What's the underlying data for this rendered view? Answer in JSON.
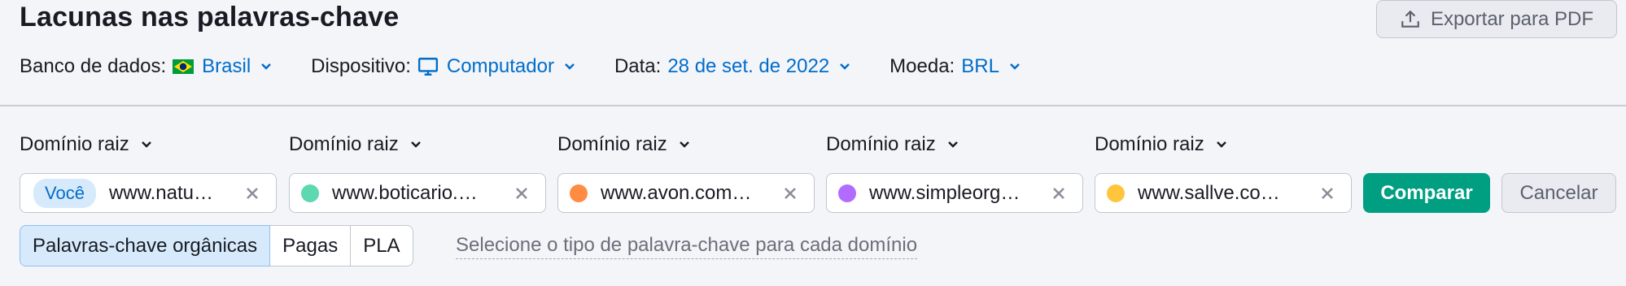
{
  "page": {
    "title": "Lacunas nas palavras-chave"
  },
  "export": {
    "label": "Exportar para PDF",
    "icon": "upload-icon"
  },
  "filters": {
    "database": {
      "label": "Banco de dados:",
      "value": "Brasil",
      "icon": "brazil-flag-icon"
    },
    "device": {
      "label": "Dispositivo:",
      "value": "Computador",
      "icon": "monitor-icon"
    },
    "date": {
      "label": "Data:",
      "value": "28 de set. de 2022"
    },
    "currency": {
      "label": "Moeda:",
      "value": "BRL"
    }
  },
  "domains": [
    {
      "type_label": "Domínio raiz",
      "value": "www.natu…",
      "badge": "Você"
    },
    {
      "type_label": "Domínio raiz",
      "value": "www.boticario.…",
      "color": "#5ed8b0"
    },
    {
      "type_label": "Domínio raiz",
      "value": "www.avon.com…",
      "color": "#ff8c42"
    },
    {
      "type_label": "Domínio raiz",
      "value": "www.simpleorg…",
      "color": "#b26bff"
    },
    {
      "type_label": "Domínio raiz",
      "value": "www.sallve.co…",
      "color": "#ffc53d"
    }
  ],
  "actions": {
    "compare": "Comparar",
    "cancel": "Cancelar"
  },
  "keyword_types": {
    "options": [
      "Palavras-chave orgânicas",
      "Pagas",
      "PLA"
    ],
    "selected": "Palavras-chave orgânicas",
    "hint": "Selecione o tipo de palavra-chave para cada domínio"
  }
}
